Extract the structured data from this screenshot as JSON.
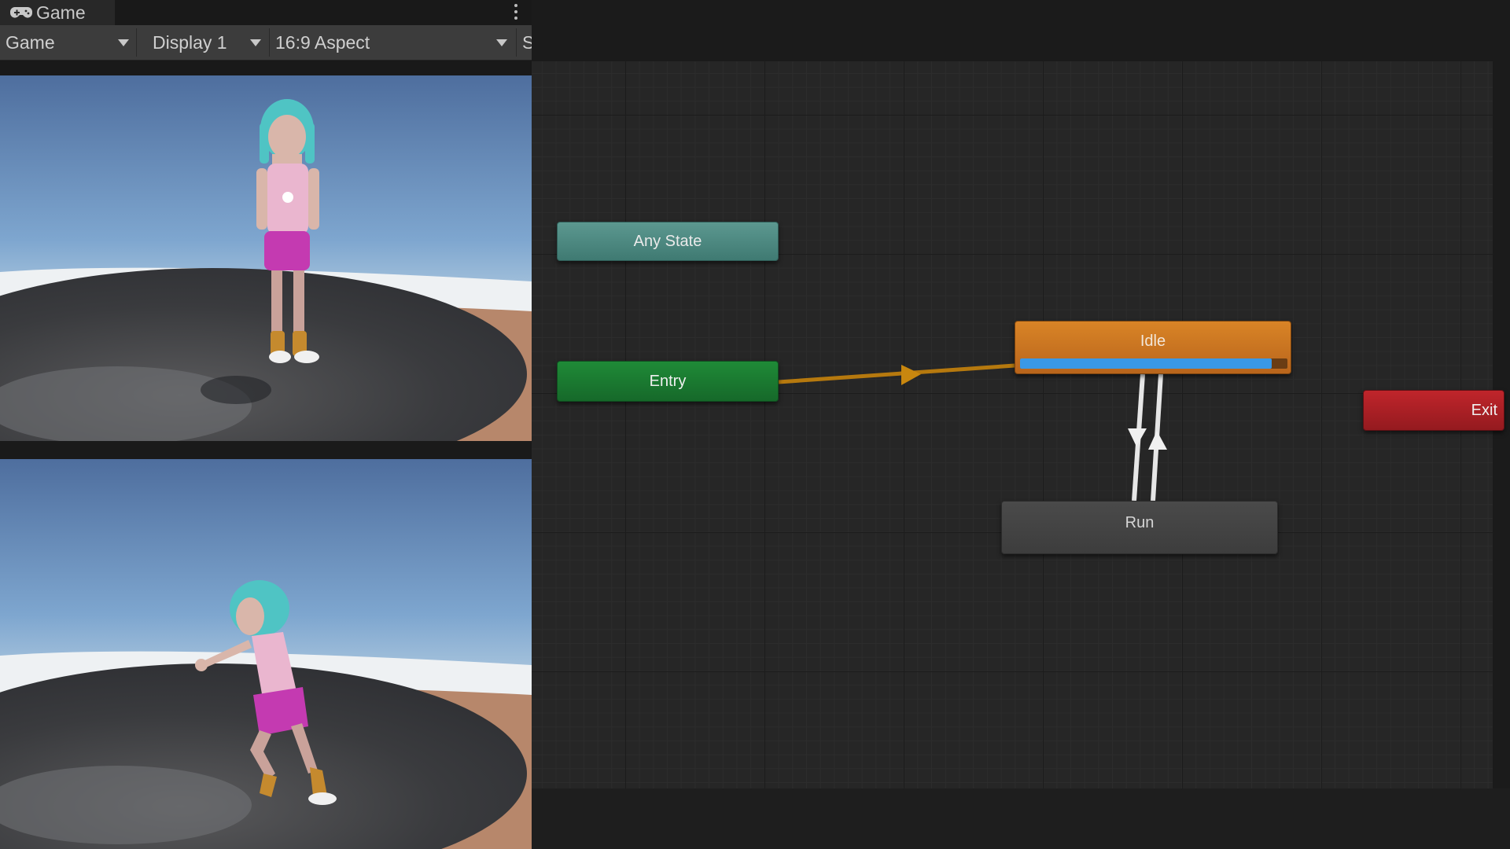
{
  "game_window": {
    "tab_label": "Game",
    "tab_icon": "gamepad-icon",
    "toolbar": {
      "mode": "Game",
      "display": "Display 1",
      "aspect": "16:9 Aspect",
      "cut_label": "S"
    }
  },
  "animator": {
    "states": {
      "any_state": "Any State",
      "entry": "Entry",
      "idle": "Idle",
      "run": "Run",
      "exit": "Exit"
    },
    "idle_progress": 0.94,
    "colors": {
      "any_state": "#4f8c84",
      "entry": "#1a7a30",
      "idle_default": "#c8731f",
      "progress": "#3a98e6",
      "run": "#444444",
      "exit": "#a8202a",
      "transition_default": "#b6790e",
      "transition": "#e6e6e6"
    },
    "transitions": [
      {
        "from": "Entry",
        "to": "Idle"
      },
      {
        "from": "Idle",
        "to": "Run"
      },
      {
        "from": "Run",
        "to": "Idle"
      }
    ]
  }
}
